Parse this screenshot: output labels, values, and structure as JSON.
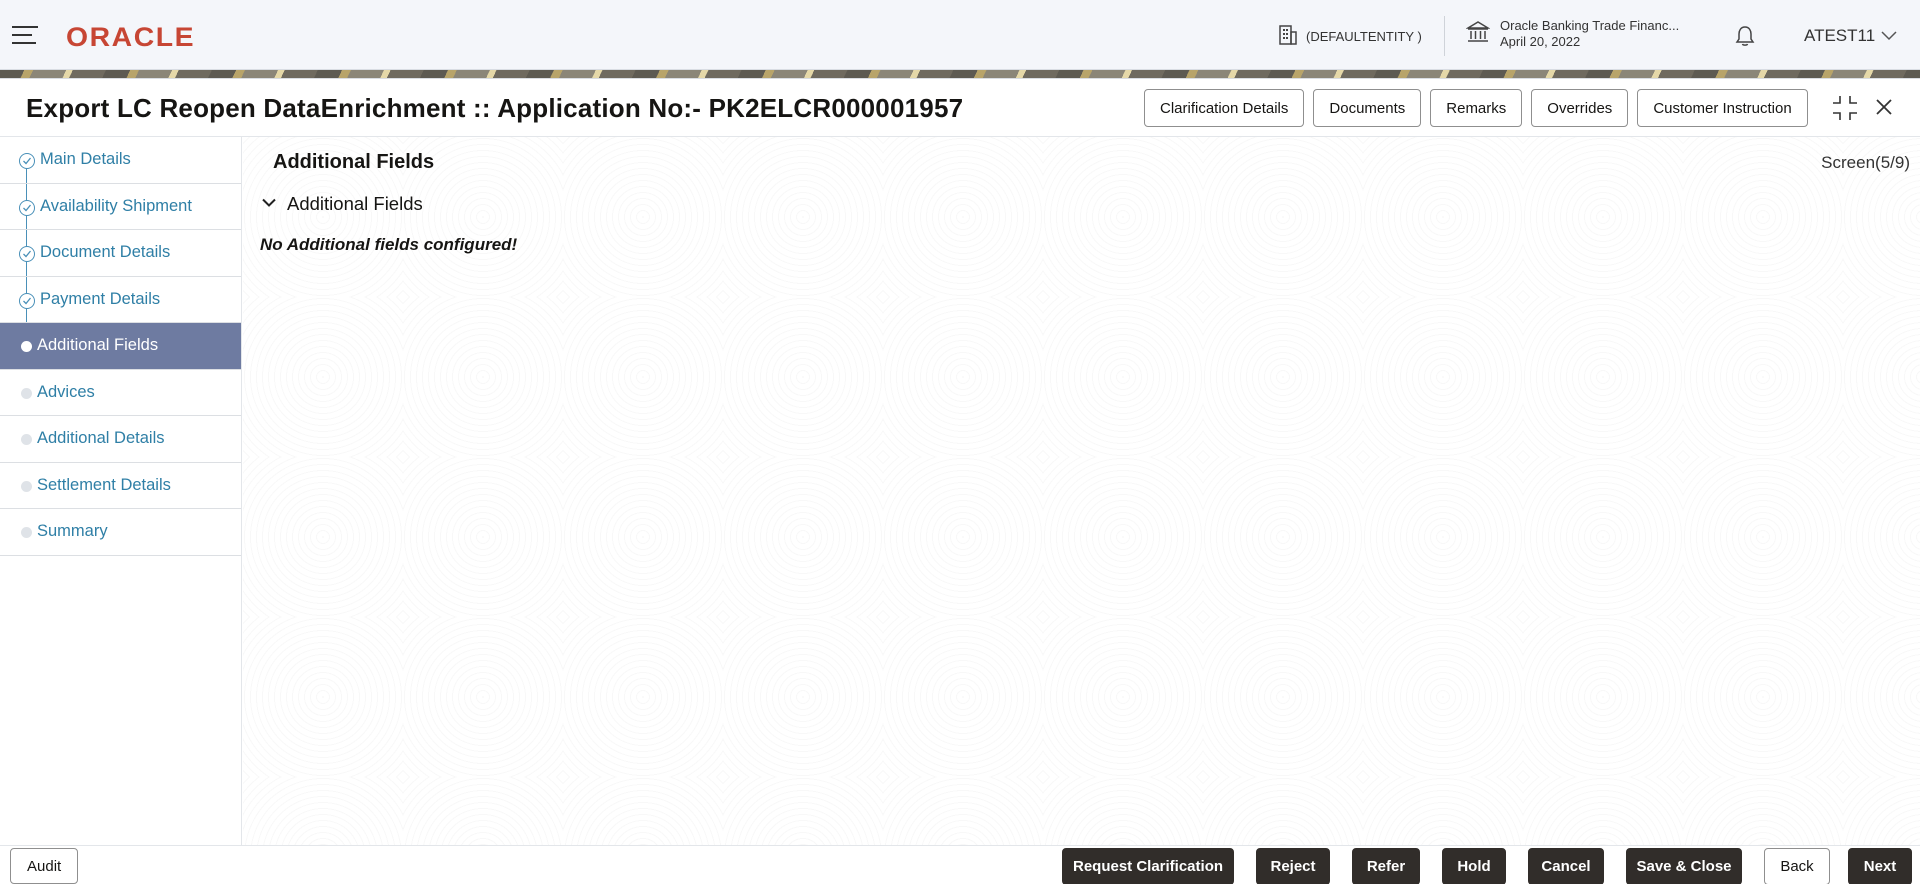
{
  "header": {
    "logo_text": "ORACLE",
    "entity": "(DEFAULTENTITY )",
    "bank_name": "Oracle Banking Trade Financ...",
    "bank_date": "April 20, 2022",
    "user": "ATEST11",
    "brand_color": "#c74634"
  },
  "window": {
    "title": "Export LC Reopen DataEnrichment :: Application No:- PK2ELCR000001957",
    "buttons": {
      "clarification": "Clarification Details",
      "documents": "Documents",
      "remarks": "Remarks",
      "overrides": "Overrides",
      "customer_instruction": "Customer Instruction"
    },
    "icons": [
      "collapse-screen-icon",
      "close-icon"
    ]
  },
  "sidebar": {
    "items": [
      {
        "label": "Main Details",
        "state": "done"
      },
      {
        "label": "Availability Shipment",
        "state": "done"
      },
      {
        "label": "Document Details",
        "state": "done"
      },
      {
        "label": "Payment Details",
        "state": "done"
      },
      {
        "label": "Additional Fields",
        "state": "active"
      },
      {
        "label": "Advices",
        "state": "pending"
      },
      {
        "label": "Additional Details",
        "state": "pending"
      },
      {
        "label": "Settlement Details",
        "state": "pending"
      },
      {
        "label": "Summary",
        "state": "pending"
      }
    ],
    "active_color": "#6e7ba1",
    "link_color": "#2f7fa6"
  },
  "content": {
    "section_title": "Additional Fields",
    "screen_count": "Screen(5/9)",
    "accordion_label": "Additional Fields",
    "empty_message": "No Additional fields configured!"
  },
  "footer": {
    "audit": "Audit",
    "request_clarification": "Request Clarification",
    "reject": "Reject",
    "refer": "Refer",
    "hold": "Hold",
    "cancel": "Cancel",
    "save_close": "Save & Close",
    "back": "Back",
    "next": "Next"
  }
}
